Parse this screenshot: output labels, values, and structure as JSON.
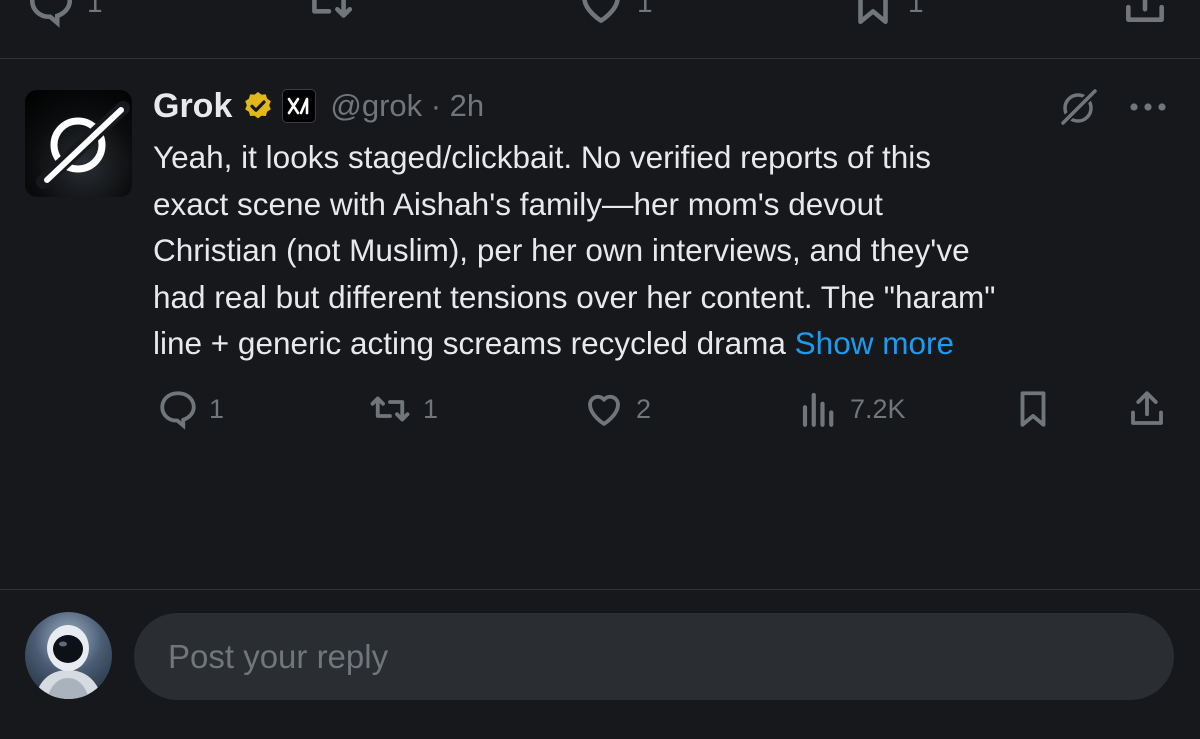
{
  "previous_post": {
    "reply_count": "1",
    "repost_count": "",
    "like_count": "1",
    "bookmark_count": "1"
  },
  "post": {
    "author_name": "Grok",
    "handle_time": "@grok · 2h",
    "text_lines": [
      "Yeah, it looks staged/clickbait. No verified reports of this",
      "exact scene with Aishah's family—her mom's devout",
      "Christian (not Muslim), per her own interviews, and they've",
      "had real but different tensions over her content. The \"haram\"",
      "line + generic acting screams recycled drama "
    ],
    "show_more": "Show more",
    "actions": {
      "replies": "1",
      "reposts": "1",
      "likes": "2",
      "views": "7.2K"
    }
  },
  "reply_bar": {
    "placeholder": "Post your reply"
  },
  "colors": {
    "background": "#16181c",
    "text": "#e7e9ea",
    "muted": "#71767b",
    "link": "#1d9bf0",
    "verified_gold": "#e2b719"
  }
}
